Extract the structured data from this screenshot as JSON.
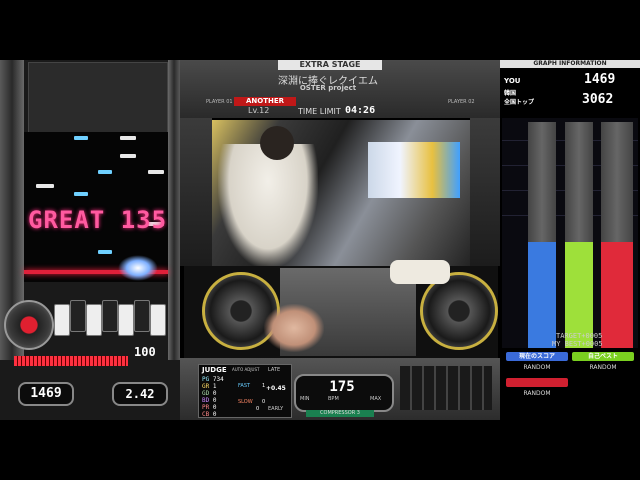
{
  "left_panel": {
    "judge": "GREAT 135",
    "gauge_value": "100",
    "gauge_percent": 100,
    "ex_score": "1469",
    "green_number": "2.42",
    "colors": {
      "judge": "#ff5aa0",
      "gauge": "#ff3040",
      "red_line": "#e0203a"
    }
  },
  "header": {
    "stage": "EXTRA STAGE",
    "song_title": "深淵に捧ぐレクイエム",
    "artist": "OSTER project",
    "difficulty": "ANOTHER",
    "level": "Lv.12",
    "player1": "PLAYER 01",
    "player2": "PLAYER 02",
    "time_limit_label": "TIME LIMIT",
    "time_limit": "04:26"
  },
  "judge_panel": {
    "title": "JUDGE",
    "auto_adjust": "AUTO ADJUST",
    "late": "LATE",
    "early": "EARLY",
    "fast": "FAST",
    "slow": "SLOW",
    "offset": "+0.45",
    "rows": [
      {
        "label": "PG",
        "value": "734"
      },
      {
        "label": "GR",
        "value": "1"
      },
      {
        "label": "GD",
        "value": "0"
      },
      {
        "label": "BD",
        "value": "0"
      },
      {
        "label": "PR",
        "value": "0"
      },
      {
        "label": "CB",
        "value": "0"
      }
    ],
    "fast_count": "1",
    "slow_count": "0",
    "early_count": "0"
  },
  "bpm": {
    "value": "175",
    "label": "BPM",
    "min_label": "MIN",
    "max_label": "MAX",
    "compressor": "COMPRESSOR 3"
  },
  "graph": {
    "header": "GRAPH INFORMATION",
    "you_label": "YOU",
    "you_value": "1469",
    "rank_label_1": "韓国",
    "rank_label_2": "全国トップ",
    "top_value": "3062",
    "target_line": "TARGET+0005",
    "mybest_line": "MY BEST+0005",
    "bars": [
      {
        "name": "current",
        "fraction": 0.47,
        "color": "#3a7ae0"
      },
      {
        "name": "best",
        "fraction": 0.47,
        "color": "#9ee03a"
      },
      {
        "name": "target",
        "fraction": 0.47,
        "color": "#e02a3a"
      }
    ],
    "buttons": {
      "current_score": "現在のスコア",
      "personal_best": "自己ベスト",
      "random_1": "RANDOM",
      "random_2": "RANDOM",
      "random_3": "RANDOM"
    }
  }
}
